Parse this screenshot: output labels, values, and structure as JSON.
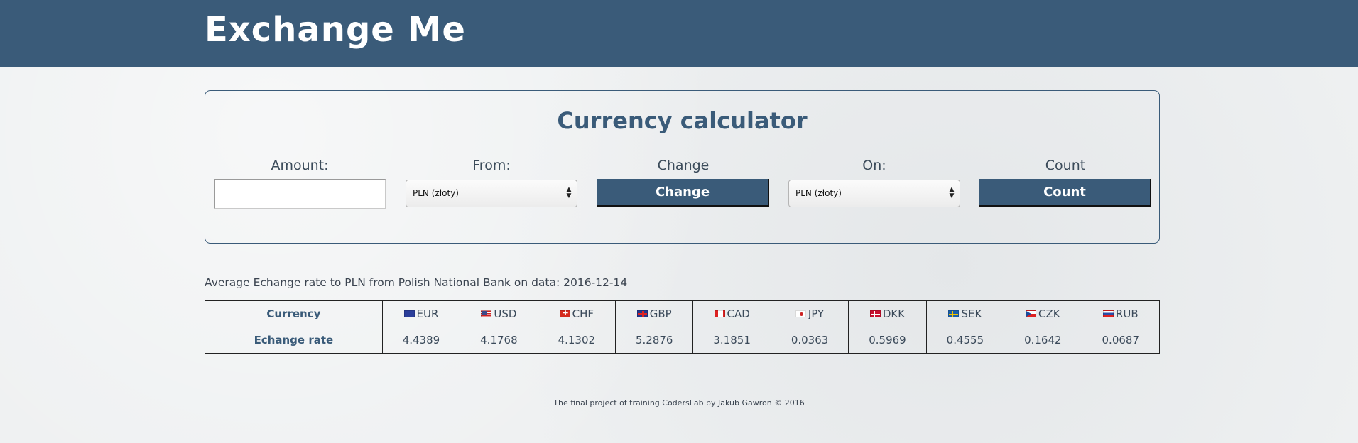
{
  "header": {
    "title": "Exchange Me"
  },
  "calculator": {
    "title": "Currency calculator",
    "amount_label": "Amount:",
    "amount_value": "",
    "from_label": "From:",
    "from_selected": "PLN (złoty)",
    "change_label": "Change",
    "change_button": "Change",
    "on_label": "On:",
    "on_selected": "PLN (złoty)",
    "count_label": "Count",
    "count_button": "Count"
  },
  "rates": {
    "info": "Average Echange rate to PLN from Polish National Bank on data: 2016-12-14",
    "header_label": "Currency",
    "rate_label": "Echange rate",
    "currencies": [
      {
        "code": "EUR",
        "flag": "eu-flag-icon",
        "rate": "4.4389"
      },
      {
        "code": "USD",
        "flag": "us-flag-icon",
        "rate": "4.1768"
      },
      {
        "code": "CHF",
        "flag": "ch-flag-icon",
        "rate": "4.1302"
      },
      {
        "code": "GBP",
        "flag": "gb-flag-icon",
        "rate": "5.2876"
      },
      {
        "code": "CAD",
        "flag": "ca-flag-icon",
        "rate": "3.1851"
      },
      {
        "code": "JPY",
        "flag": "jp-flag-icon",
        "rate": "0.0363"
      },
      {
        "code": "DKK",
        "flag": "dk-flag-icon",
        "rate": "0.5969"
      },
      {
        "code": "SEK",
        "flag": "se-flag-icon",
        "rate": "0.4555"
      },
      {
        "code": "CZK",
        "flag": "cz-flag-icon",
        "rate": "0.1642"
      },
      {
        "code": "RUB",
        "flag": "ru-flag-icon",
        "rate": "0.0687"
      }
    ]
  },
  "footer": {
    "text": "The final project of training CodersLab by Jakub Gawron © 2016"
  },
  "colors": {
    "brand": "#3a5b79",
    "background": "#eef0f1"
  }
}
